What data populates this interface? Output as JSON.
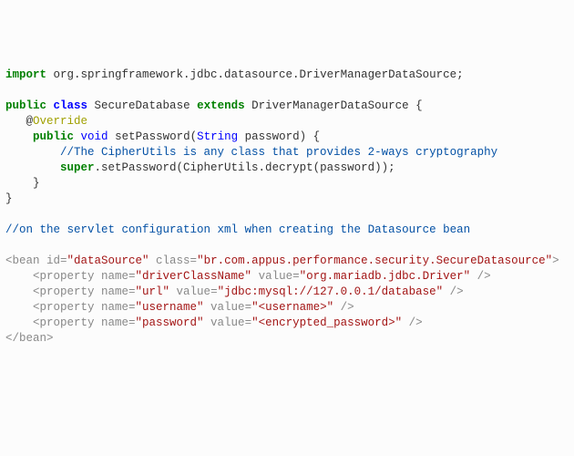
{
  "code": {
    "import_kw": "import",
    "import_pkg": " org.springframework.jdbc.datasource.DriverManagerDataSource;",
    "public_kw": "public",
    "class_kw": "class",
    "class_name": " SecureDatabase ",
    "extends_kw": "extends",
    "extends_name": " DriverManagerDataSource {",
    "at": "   @",
    "override": "Override",
    "indent4": "    ",
    "void_kw": "void",
    "setpass": " setPassword(",
    "string_type": "String",
    "paramtail": " password) {",
    "comment_inner": "        //The CipherUtils is any class that provides 2-ways cryptography",
    "indent8": "        ",
    "super_kw": "super",
    "supertail": ".setPassword(CipherUtils.decrypt(password));",
    "close1": "    }",
    "close2": "}",
    "comment_servlet": "//on the servlet configuration xml when creating the Datasource bean",
    "bean_open1": "<bean id=",
    "datasource": "\"dataSource\"",
    "class_attr": " class",
    "eq": "=",
    "bean_class": "\"br.com.appus.performance.security.SecureDatasource\"",
    "gt": ">",
    "prop_open": "    <property name=",
    "drivername": "\"driverClassName\"",
    "value_attr": " value",
    "driver_val": "\"org.mariadb.jdbc.Driver\"",
    "slashgt": " />",
    "url_name": "\"url\"",
    "url_val": "\"jdbc:mysql://127.0.0.1/database\"",
    "user_name": "\"username\"",
    "user_val": "\"<username>\"",
    "pass_name": "\"password\"",
    "pass_val": "\"<encrypted_password>\"",
    "bean_close": "</bean>",
    "space": " "
  }
}
